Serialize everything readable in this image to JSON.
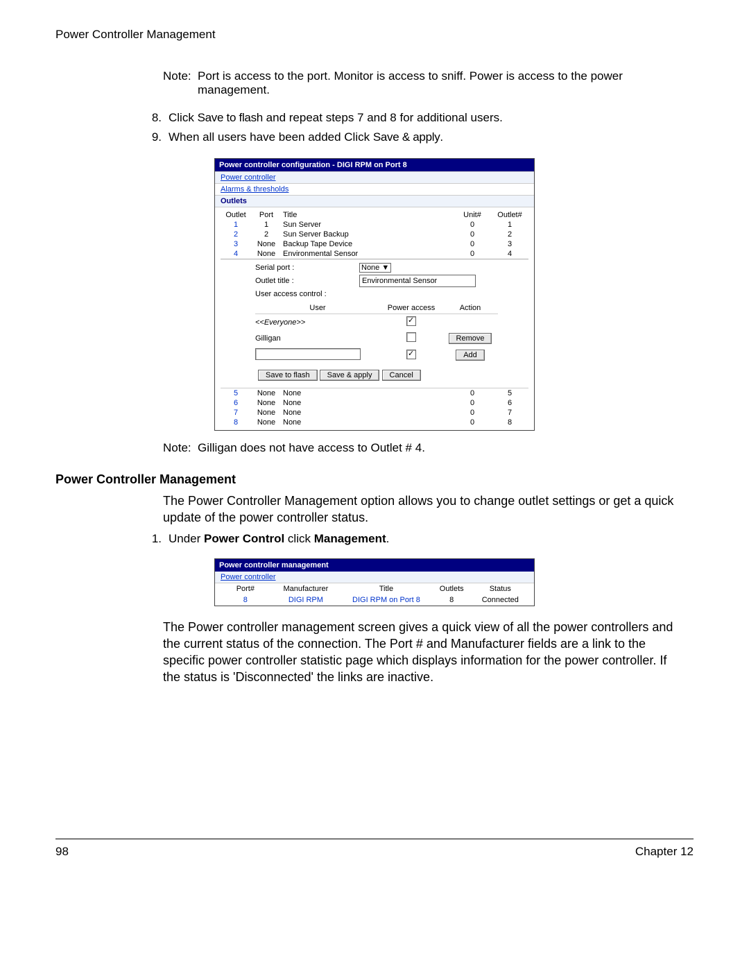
{
  "running_head": "Power Controller Management",
  "note1_label": "Note:",
  "note1_text": "Port is access to the port. Monitor is access to sniff. Power is access to the power management.",
  "step8_num": "8.",
  "step8_a": "Click ",
  "step8_b": "Save to flash",
  "step8_c": " and repeat steps 7 and 8 for additional users.",
  "step9_num": "9.",
  "step9_a": "When all users have been added Click ",
  "step9_b": "Save & apply",
  "step9_c": ".",
  "ss1": {
    "titlebar": "Power controller configuration - DIGI RPM on Port 8",
    "row_pc": "Power controller",
    "row_at": "Alarms & thresholds",
    "row_outlets": "Outlets",
    "head": {
      "outlet": "Outlet",
      "port": "Port",
      "title": "Title",
      "unit": "Unit#",
      "outletn": "Outlet#"
    },
    "rows_top": [
      {
        "outlet": "1",
        "port": "1",
        "title": "Sun Server",
        "unit": "0",
        "outletn": "1"
      },
      {
        "outlet": "2",
        "port": "2",
        "title": "Sun Server Backup",
        "unit": "0",
        "outletn": "2"
      },
      {
        "outlet": "3",
        "port": "None",
        "title": "Backup Tape Device",
        "unit": "0",
        "outletn": "3"
      },
      {
        "outlet": "4",
        "port": "None",
        "title": "Environmental Sensor",
        "unit": "0",
        "outletn": "4"
      }
    ],
    "form": {
      "serial_port_lbl": "Serial port :",
      "serial_port_val": "None",
      "outlet_title_lbl": "Outlet title :",
      "outlet_title_val": "Environmental Sensor",
      "uac_lbl": "User access control :",
      "user_head": "User",
      "pa_head": "Power access",
      "action_head": "Action",
      "everyone": "<<Everyone>>",
      "gilligan": "Gilligan",
      "remove_btn": "Remove",
      "add_btn": "Add",
      "save_flash": "Save to flash",
      "save_apply": "Save & apply",
      "cancel": "Cancel"
    },
    "rows_bottom": [
      {
        "outlet": "5",
        "port": "None",
        "title": "None",
        "unit": "0",
        "outletn": "5"
      },
      {
        "outlet": "6",
        "port": "None",
        "title": "None",
        "unit": "0",
        "outletn": "6"
      },
      {
        "outlet": "7",
        "port": "None",
        "title": "None",
        "unit": "0",
        "outletn": "7"
      },
      {
        "outlet": "8",
        "port": "None",
        "title": "None",
        "unit": "0",
        "outletn": "8"
      }
    ]
  },
  "note2_label": "Note:",
  "note2_text": "Gilligan does not have access to Outlet # 4.",
  "section_head": "Power Controller Management",
  "para1": "The Power Controller Management option allows you to change outlet settings or get a quick update of the power controller status.",
  "step1_num": "1.",
  "step1_a": "Under ",
  "step1_b": "Power Control",
  "step1_c": " click ",
  "step1_d": "Management",
  "step1_e": ".",
  "ss2": {
    "titlebar": "Power controller management",
    "row_pc": "Power controller",
    "head": {
      "port": "Port#",
      "mfr": "Manufacturer",
      "title": "Title",
      "outlets": "Outlets",
      "status": "Status"
    },
    "row": {
      "port": "8",
      "mfr": "DIGI RPM",
      "title": "DIGI RPM on Port 8",
      "outlets": "8",
      "status": "Connected"
    }
  },
  "para2": "The Power controller management screen gives a quick view of all the power controllers and the current status of the connection. The Port # and Manufacturer fields are a link to the specific power controller statistic page which displays information for the power controller. If the status is 'Disconnected' the links are inactive.",
  "footer_page": "98",
  "footer_chapter": "Chapter 12"
}
